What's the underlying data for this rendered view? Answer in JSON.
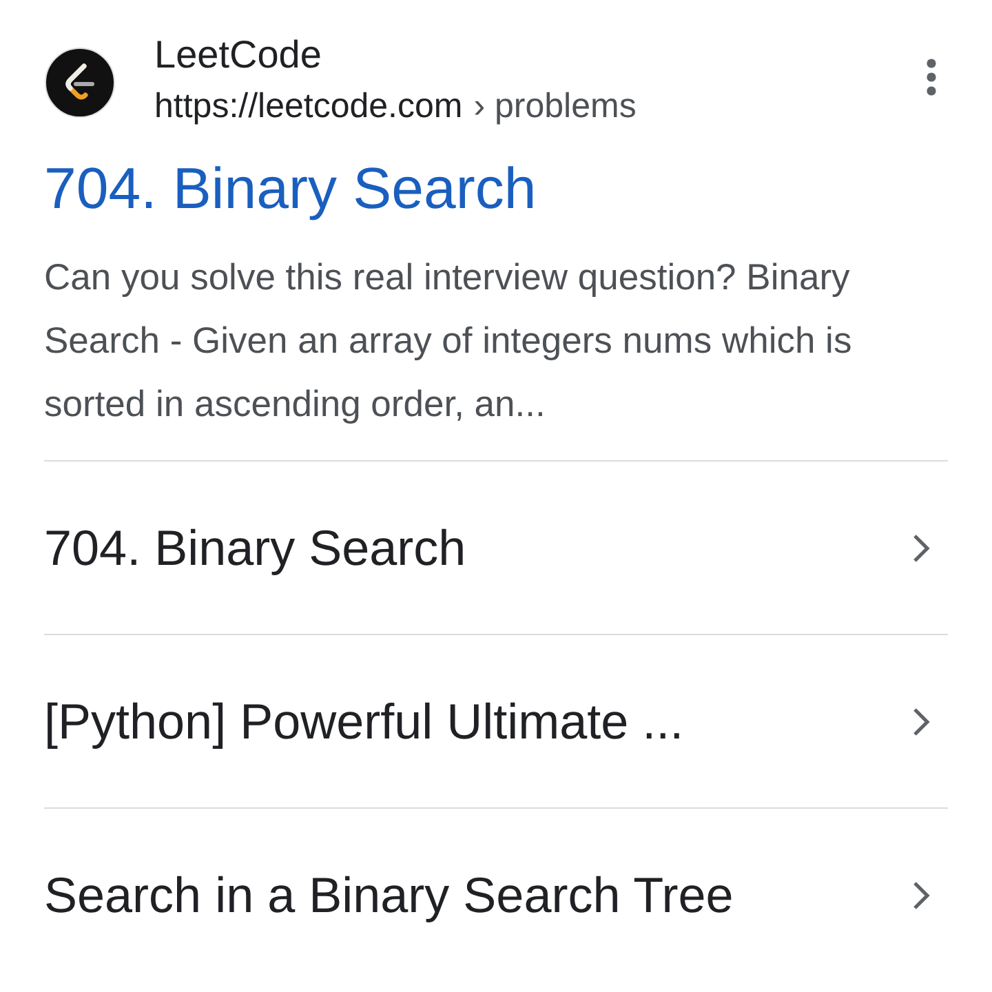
{
  "site": {
    "name": "LeetCode",
    "url": "https://leetcode.com",
    "path": "› problems"
  },
  "result": {
    "title": "704. Binary Search",
    "snippet": "Can you solve this real interview question? Binary Search - Given an array of integers nums which is sorted in ascending order, an..."
  },
  "sublinks": [
    {
      "label": "704. Binary Search"
    },
    {
      "label": "[Python] Powerful Ultimate ..."
    },
    {
      "label": "Search in a Binary Search Tree"
    }
  ]
}
